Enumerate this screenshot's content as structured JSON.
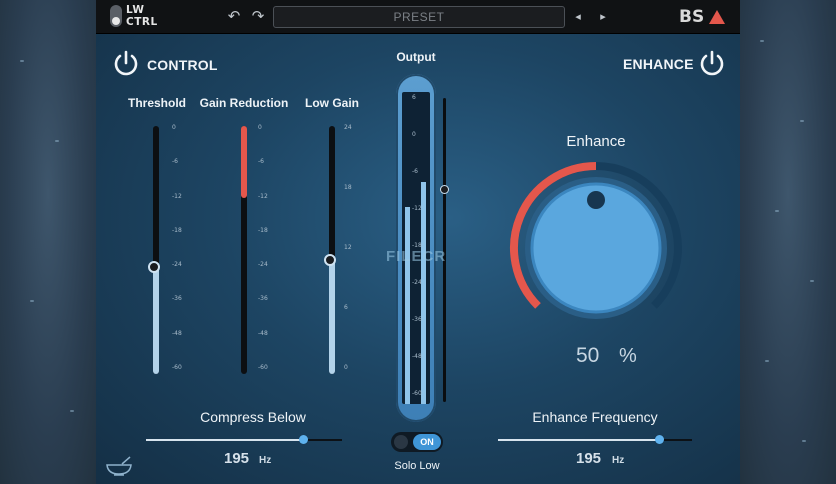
{
  "logo": {
    "text": "LW\nCTRL"
  },
  "topbar": {
    "undo_icon": "undo-icon",
    "redo_icon": "redo-icon",
    "preset_label": "PRESET",
    "prev_icon": "chevron-left-icon",
    "next_icon": "chevron-right-icon",
    "brand_text": "BS"
  },
  "control": {
    "label": "CONTROL",
    "power_icon": "power-icon"
  },
  "enhance_section": {
    "label": "ENHANCE",
    "power_icon": "power-icon"
  },
  "threshold": {
    "label": "Threshold",
    "ticks": [
      "0",
      "-6",
      "-12",
      "-18",
      "-24",
      "-36",
      "-48",
      "-60"
    ],
    "level": 0.43
  },
  "gain_reduction": {
    "label": "Gain Reduction",
    "ticks": [
      "0",
      "-6",
      "-12",
      "-18",
      "-24",
      "-36",
      "-48",
      "-60"
    ],
    "level": 0.29
  },
  "low_gain": {
    "label": "Low Gain",
    "ticks": [
      "24",
      "18",
      "12",
      "6",
      "0"
    ],
    "level": 0.46
  },
  "output": {
    "label": "Output",
    "ticks": [
      "6",
      "0",
      "-6",
      "-12",
      "-18",
      "-24",
      "-36",
      "-48",
      "-60"
    ],
    "left_level": 0.63,
    "right_level": 0.71,
    "fader_level": 0.7
  },
  "watermark": "FILECR",
  "compress_below": {
    "label": "Compress Below",
    "value": "195",
    "unit": "Hz",
    "level": 0.8
  },
  "solo_low": {
    "label": "Solo Low",
    "state": "ON"
  },
  "enhance": {
    "label": "Enhance",
    "value": "50",
    "unit": "%",
    "level": 0.5
  },
  "enhance_frequency": {
    "label": "Enhance Frequency",
    "value": "195",
    "unit": "Hz",
    "level": 0.83
  },
  "colors": {
    "accent_red": "#e4574c",
    "accent_blue": "#3f95d6",
    "panel": "#1d4563"
  }
}
